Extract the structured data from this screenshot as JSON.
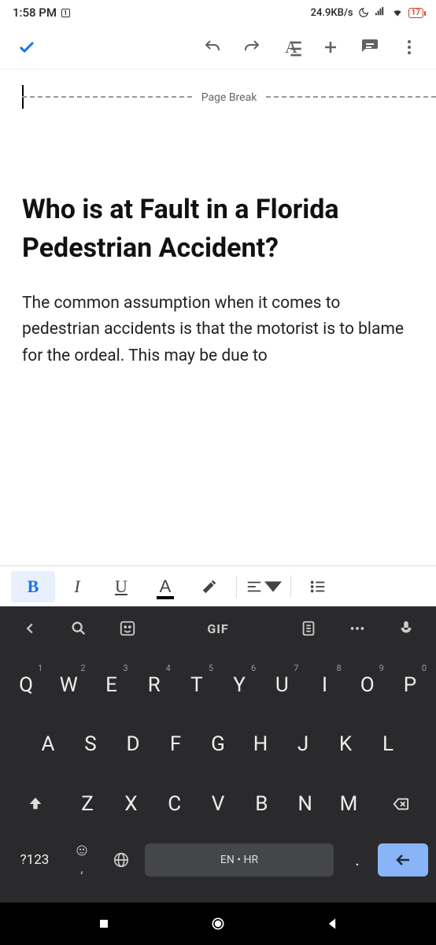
{
  "status": {
    "time": "1:58 PM",
    "net": "24.9KB/s",
    "battery": "17"
  },
  "toolbar": {
    "text_format": "A"
  },
  "doc": {
    "page_break": "Page Break",
    "heading": "Who is at Fault in a Florida Pedestrian Accident?",
    "body": "The common assumption when it comes to pedestrian accidents is that the motorist is to blame for the ordeal. This may be due to"
  },
  "format": {
    "bold": "B",
    "italic": "I",
    "underline": "U",
    "textcolor": "A"
  },
  "keyboard": {
    "gif": "GIF",
    "row1": [
      {
        "k": "Q",
        "n": "1"
      },
      {
        "k": "W",
        "n": "2"
      },
      {
        "k": "E",
        "n": "3"
      },
      {
        "k": "R",
        "n": "4"
      },
      {
        "k": "T",
        "n": "5"
      },
      {
        "k": "Y",
        "n": "6"
      },
      {
        "k": "U",
        "n": "7"
      },
      {
        "k": "I",
        "n": "8"
      },
      {
        "k": "O",
        "n": "9"
      },
      {
        "k": "P",
        "n": "0"
      }
    ],
    "row2": [
      "A",
      "S",
      "D",
      "F",
      "G",
      "H",
      "J",
      "K",
      "L"
    ],
    "row3": [
      "Z",
      "X",
      "C",
      "V",
      "B",
      "N",
      "M"
    ],
    "sym": "?123",
    "space": "EN • HR",
    "comma": ",",
    "period": "."
  }
}
